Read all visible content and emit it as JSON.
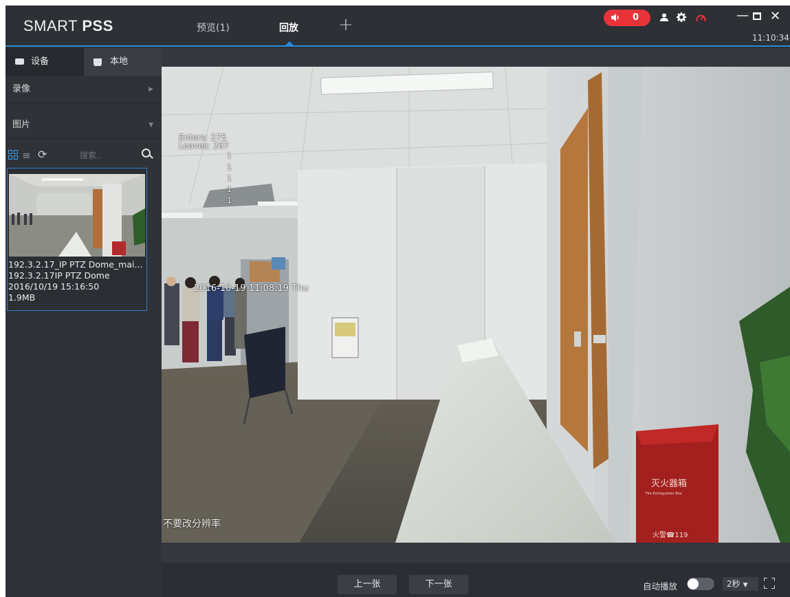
{
  "app": {
    "logo_light": "SMART ",
    "logo_bold": "PSS"
  },
  "titlebar": {
    "tabs": [
      {
        "label": "预览(1)"
      },
      {
        "label": "回放"
      }
    ],
    "add_tab": "+",
    "alarm_count": "0",
    "clock": "11:10:34",
    "icons": [
      "speaker-icon",
      "user-icon",
      "gear-icon",
      "gauge-icon",
      "minimize-icon",
      "maximize-icon",
      "close-icon"
    ],
    "alarm_color": "#e8333a",
    "accent_color": "#2a8ad8"
  },
  "sidebar": {
    "segments": [
      {
        "label": "设备"
      },
      {
        "label": "本地"
      }
    ],
    "sections": [
      {
        "label": "录像"
      },
      {
        "label": "图片"
      }
    ],
    "search": {
      "placeholder": "搜索.."
    },
    "thumbnail": {
      "name": "192.3.2.17_IP PTZ Dome_mai...",
      "device": "192.3.2.17IP PTZ Dome",
      "datetime": "2016/10/19 15:16:50",
      "size": "1.9MB"
    }
  },
  "viewer": {
    "overlay": {
      "enters": "Enters: 275",
      "leaves": "Leaves: 267",
      "counters": [
        "1",
        "1",
        "1",
        "1",
        "1"
      ],
      "datetime": "2016-10-19 11:08:19 Thu",
      "channel_name": "不要改分辨率"
    },
    "scene_labels": {
      "extinguisher_title": "灭火器箱",
      "extinguisher_sub": "Fire Extinguisher Box",
      "extinguisher_phone": "火警☎119"
    }
  },
  "controls": {
    "prev_label": "上一张",
    "next_label": "下一张",
    "autoplay_label": "自动播放",
    "autoplay_on": false,
    "interval": "2秒"
  }
}
